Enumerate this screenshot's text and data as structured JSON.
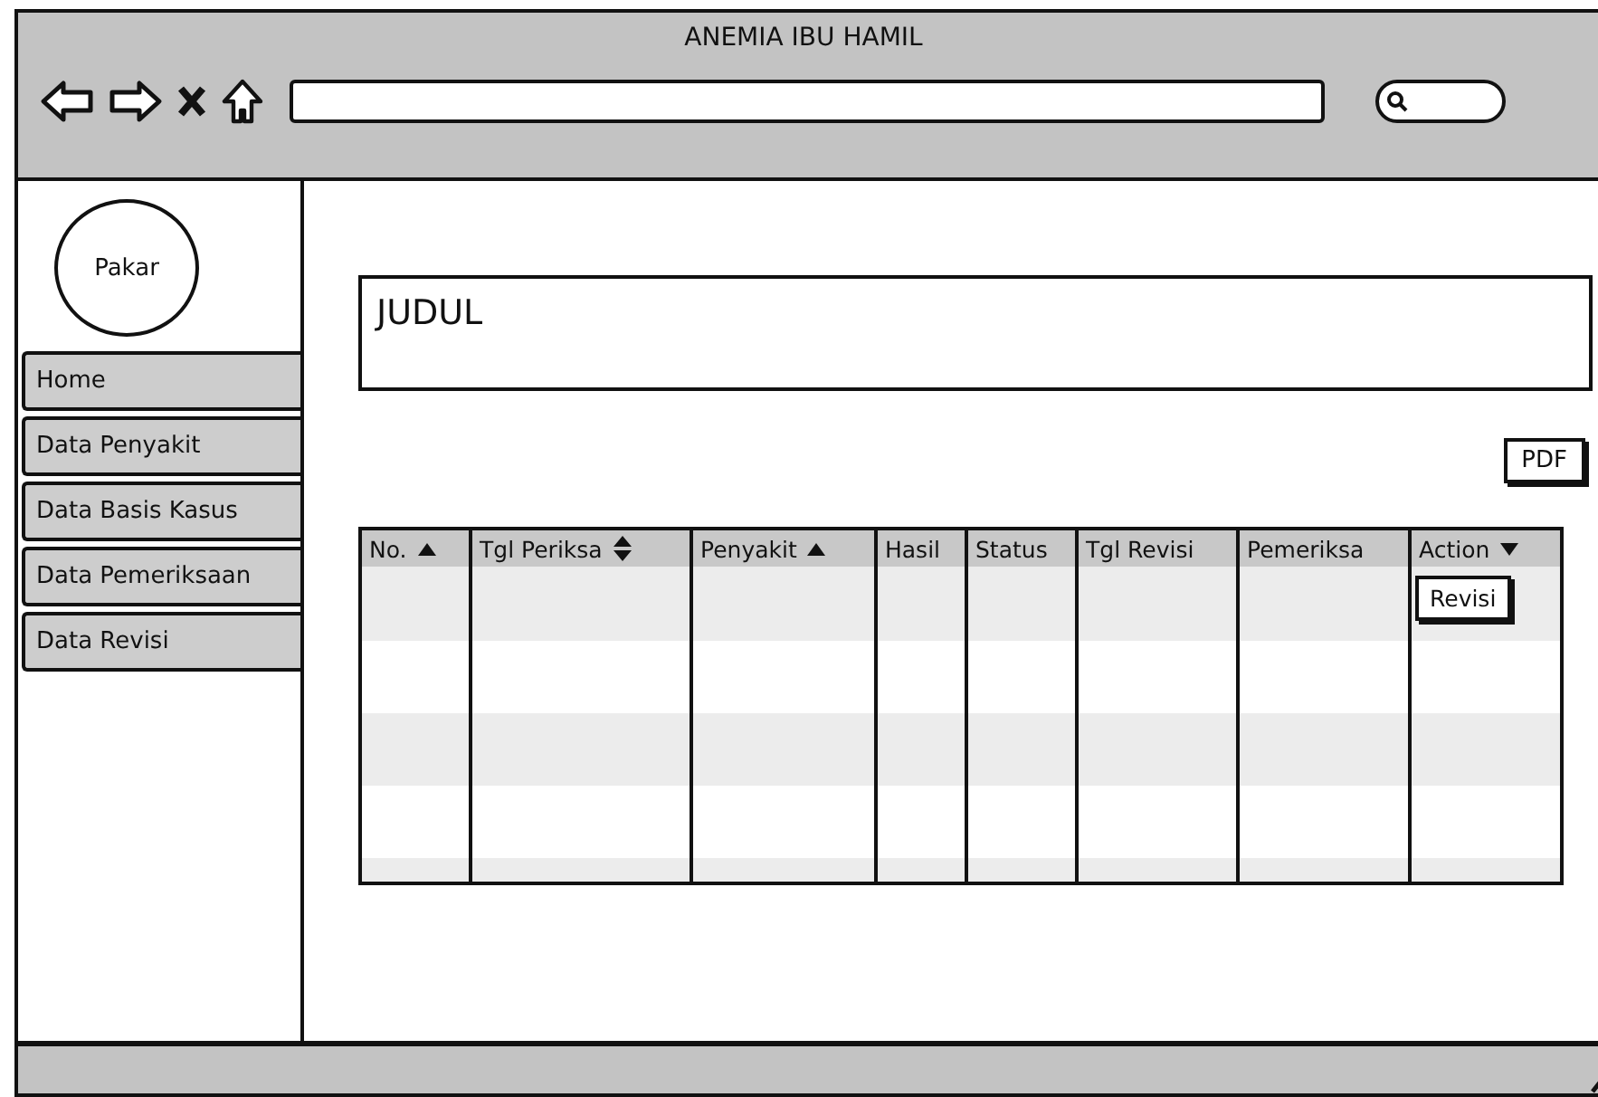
{
  "window": {
    "title": "ANEMIA IBU HAMIL"
  },
  "sidebar": {
    "avatar_label": "Pakar",
    "items": [
      {
        "label": "Home"
      },
      {
        "label": "Data Penyakit"
      },
      {
        "label": "Data Basis Kasus"
      },
      {
        "label": "Data Pemeriksaan"
      },
      {
        "label": "Data Revisi"
      }
    ]
  },
  "heading": "JUDUL",
  "pdf_button": "PDF",
  "table": {
    "columns": [
      {
        "label": "No.",
        "kind": "ascending"
      },
      {
        "label": "Tgl Periksa",
        "kind": "sortable"
      },
      {
        "label": "Penyakit",
        "kind": "ascending"
      },
      {
        "label": "Hasil",
        "kind": "plain"
      },
      {
        "label": "Status",
        "kind": "plain"
      },
      {
        "label": "Tgl Revisi",
        "kind": "plain"
      },
      {
        "label": "Pemeriksa",
        "kind": "plain"
      },
      {
        "label": "Action",
        "kind": "dropdown"
      }
    ],
    "rows": [
      {
        "action": "Revisi"
      }
    ]
  }
}
